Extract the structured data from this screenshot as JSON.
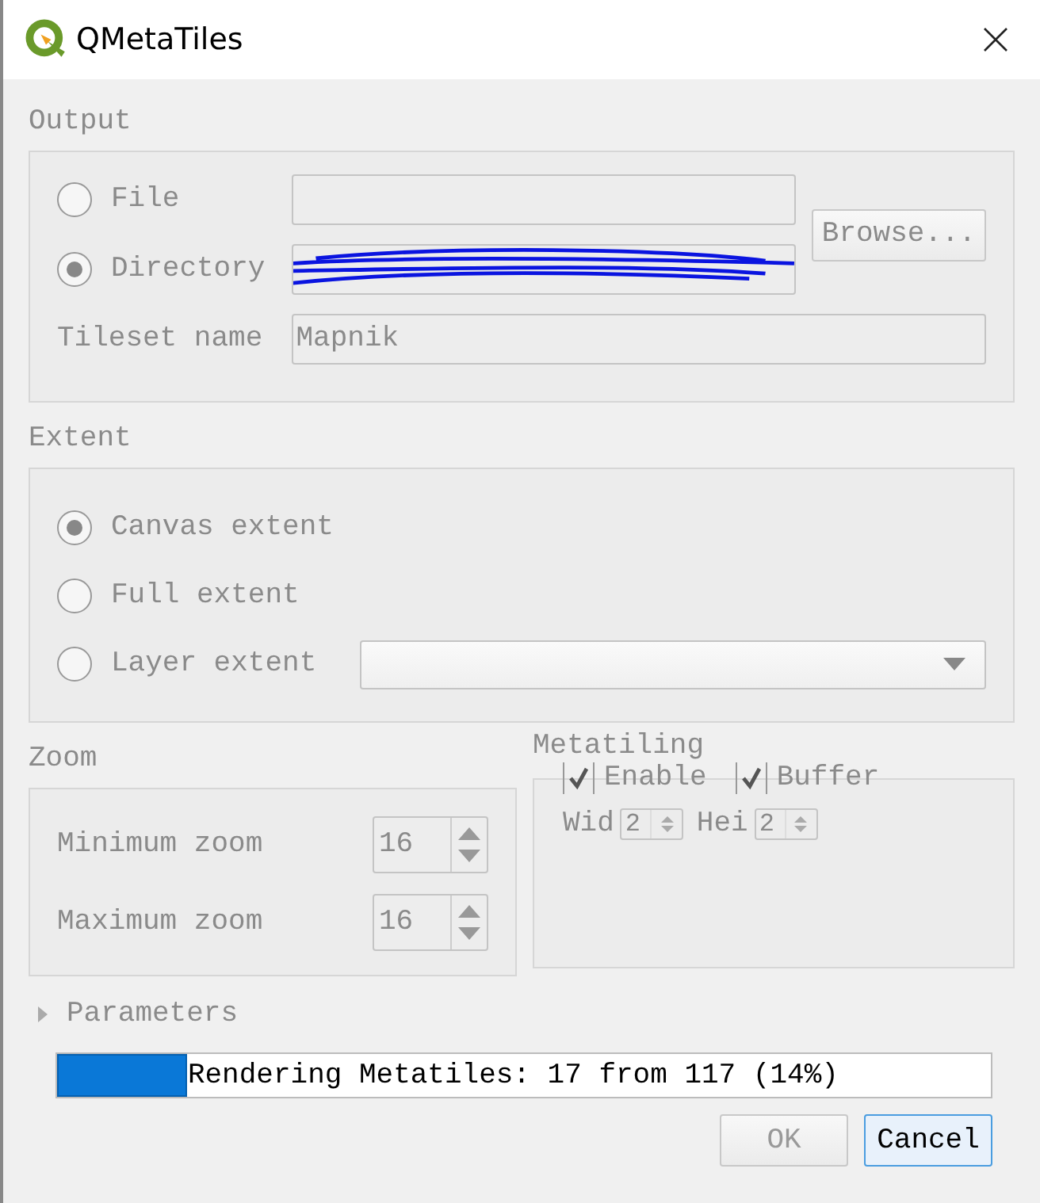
{
  "window": {
    "title": "QMetaTiles"
  },
  "form_disabled": true,
  "output": {
    "title": "Output",
    "modes": [
      {
        "label": "File",
        "selected": false,
        "redacted": false
      },
      {
        "label": "Directory",
        "selected": true,
        "redacted": true
      }
    ],
    "browse": "Browse...",
    "tileset": {
      "label": "Tileset name",
      "value": "Mapnik"
    }
  },
  "extent": {
    "title": "Extent",
    "options": [
      {
        "label": "Canvas extent",
        "selected": true,
        "has_dropdown": false
      },
      {
        "label": "Full extent",
        "selected": false,
        "has_dropdown": false
      },
      {
        "label": "Layer extent",
        "selected": false,
        "has_dropdown": true
      }
    ]
  },
  "zoom": {
    "title": "Zoom",
    "fields": [
      {
        "label": "Minimum zoom",
        "value": "16"
      },
      {
        "label": "Maximum zoom",
        "value": "16"
      }
    ]
  },
  "metatiling": {
    "title": "Metatiling",
    "checks": [
      {
        "label": "Enable",
        "checked": true
      },
      {
        "label": "Buffer",
        "checked": true
      }
    ],
    "sizes": [
      {
        "label": "Wid",
        "value": "2"
      },
      {
        "label": "Hei",
        "value": "2"
      }
    ]
  },
  "parameters": {
    "label": "Parameters",
    "expanded": false
  },
  "progress": {
    "text": "Rendering Metatiles: 17 from 117 (14%)",
    "level": 0.14
  },
  "buttons": [
    {
      "label": "OK",
      "disabled": true,
      "focused": false
    },
    {
      "label": "Cancel",
      "disabled": false,
      "focused": true
    }
  ]
}
